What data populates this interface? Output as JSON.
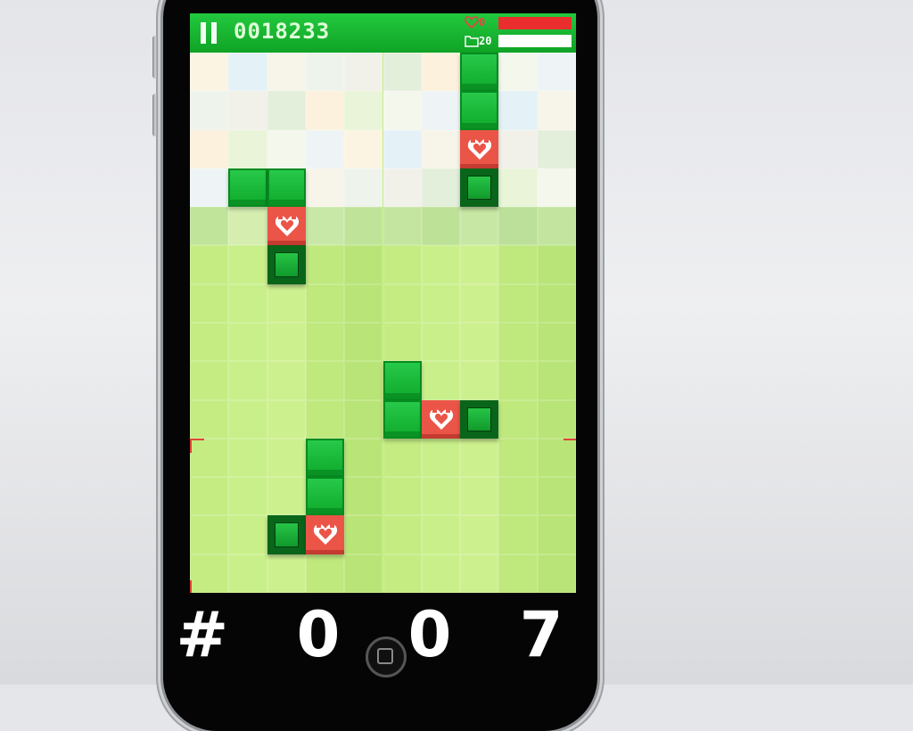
{
  "hud": {
    "score": "0018233",
    "lives_count": "0",
    "level_count": "20",
    "life_fraction": 1.0,
    "level_fraction": 1.0,
    "icons": [
      "pause-icon",
      "heart-outline-icon",
      "folder-icon"
    ]
  },
  "stage_label": "# 0 0 7",
  "board": {
    "cols": 10,
    "rows": 14,
    "blocks": [
      {
        "col": 7,
        "row": 0,
        "type": "green"
      },
      {
        "col": 7,
        "row": 1,
        "type": "green"
      },
      {
        "col": 7,
        "row": 2,
        "type": "heart"
      },
      {
        "col": 7,
        "row": 3,
        "type": "dark"
      },
      {
        "col": 1,
        "row": 3,
        "type": "green"
      },
      {
        "col": 2,
        "row": 3,
        "type": "green"
      },
      {
        "col": 2,
        "row": 4,
        "type": "heart"
      },
      {
        "col": 2,
        "row": 5,
        "type": "dark"
      },
      {
        "col": 5,
        "row": 8,
        "type": "green"
      },
      {
        "col": 5,
        "row": 9,
        "type": "green"
      },
      {
        "col": 6,
        "row": 9,
        "type": "heart"
      },
      {
        "col": 7,
        "row": 9,
        "type": "dark"
      },
      {
        "col": 3,
        "row": 10,
        "type": "green"
      },
      {
        "col": 3,
        "row": 11,
        "type": "green"
      },
      {
        "col": 2,
        "row": 12,
        "type": "dark"
      },
      {
        "col": 3,
        "row": 12,
        "type": "heart"
      }
    ]
  },
  "colors": {
    "hud_green": "#14b02f",
    "block_green": "#17b335",
    "block_dark": "#08651a",
    "heart_red": "#ea5548",
    "board_green": "#c5ec82"
  }
}
